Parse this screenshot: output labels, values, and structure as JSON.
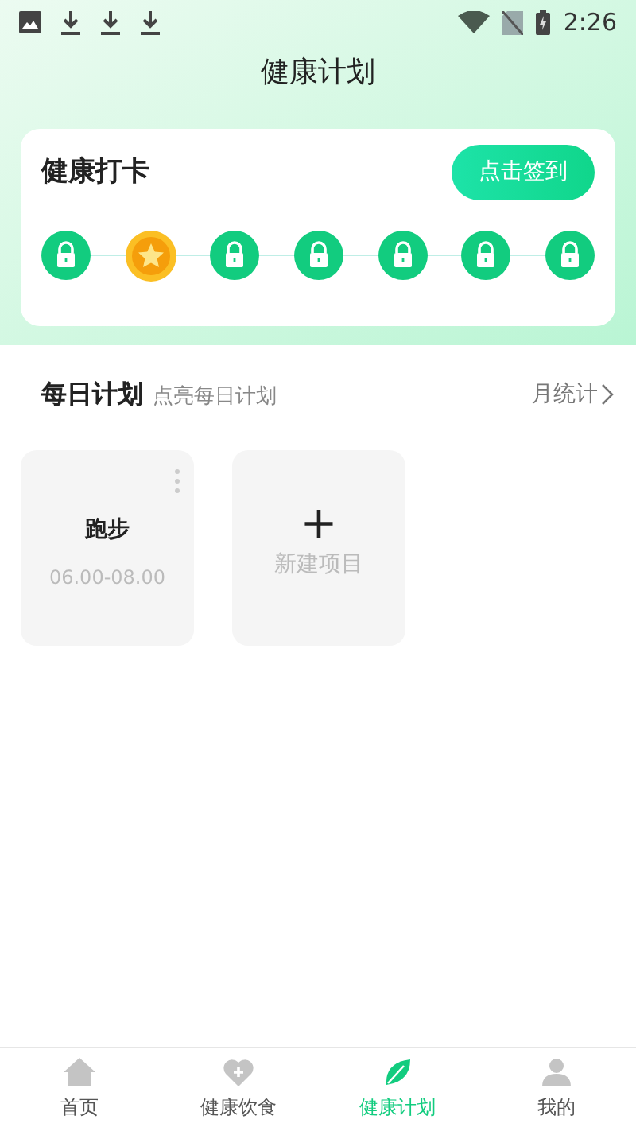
{
  "status_bar": {
    "time": "2:26"
  },
  "title": "健康计划",
  "checkin": {
    "title": "健康打卡",
    "button": "点击签到",
    "days": [
      {
        "checked": false
      },
      {
        "checked": true
      },
      {
        "checked": false
      },
      {
        "checked": false
      },
      {
        "checked": false
      },
      {
        "checked": false
      },
      {
        "checked": false
      }
    ]
  },
  "daily_plan": {
    "title": "每日计划",
    "subtitle": "点亮每日计划",
    "link": "月统计",
    "items": [
      {
        "kind": "plan",
        "name": "跑步",
        "time": "06.00-08.00"
      },
      {
        "kind": "add",
        "icon": "+",
        "label": "新建项目"
      }
    ]
  },
  "tab_bar": [
    {
      "label": "首页",
      "kind": "home",
      "selected": false
    },
    {
      "label": "健康饮食",
      "kind": "diet",
      "selected": false
    },
    {
      "label": "健康计划",
      "kind": "plan",
      "selected": true
    },
    {
      "label": "我的",
      "kind": "profile",
      "selected": false
    }
  ]
}
